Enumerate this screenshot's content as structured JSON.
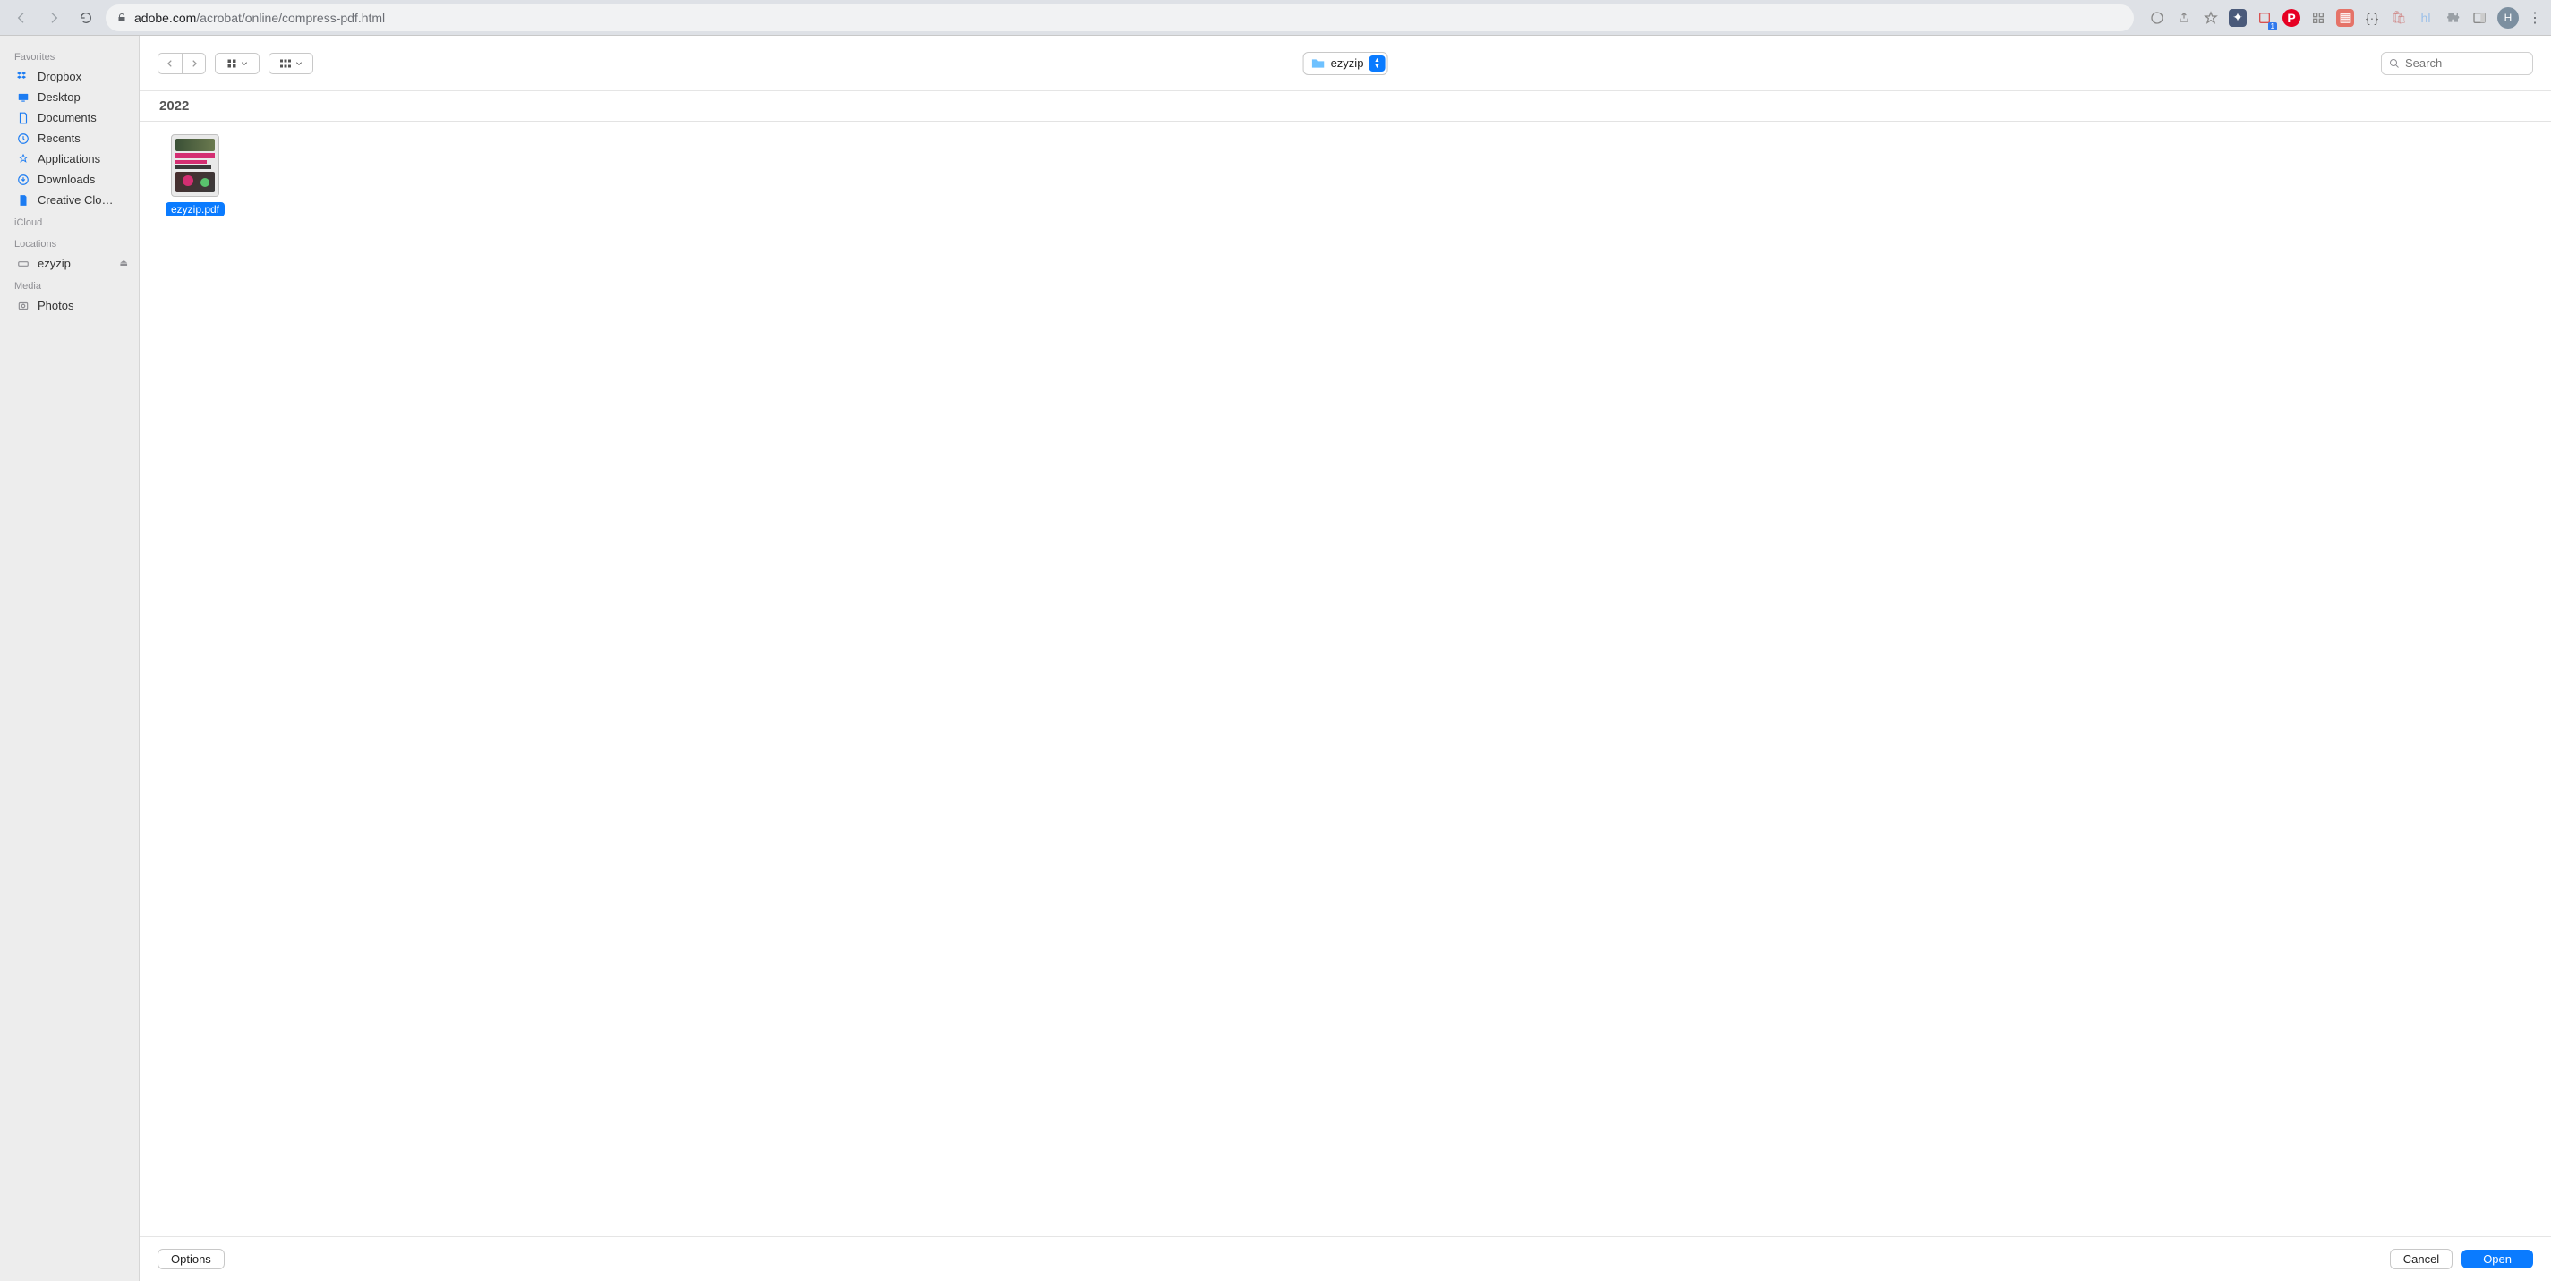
{
  "browser": {
    "url_host": "adobe.com",
    "url_path": "/acrobat/online/compress-pdf.html",
    "avatar_initial": "H",
    "ext_badge": "1"
  },
  "sidebar": {
    "sections": [
      {
        "title": "Favorites",
        "items": [
          {
            "icon": "dropbox-icon",
            "label": "Dropbox"
          },
          {
            "icon": "desktop-icon",
            "label": "Desktop"
          },
          {
            "icon": "documents-icon",
            "label": "Documents"
          },
          {
            "icon": "recents-icon",
            "label": "Recents"
          },
          {
            "icon": "applications-icon",
            "label": "Applications"
          },
          {
            "icon": "downloads-icon",
            "label": "Downloads"
          },
          {
            "icon": "file-icon",
            "label": "Creative Clo…"
          }
        ]
      },
      {
        "title": "iCloud",
        "items": []
      },
      {
        "title": "Locations",
        "items": [
          {
            "icon": "drive-icon",
            "label": "ezyzip",
            "eject": true
          }
        ]
      },
      {
        "title": "Media",
        "items": [
          {
            "icon": "photos-icon",
            "label": "Photos"
          }
        ]
      }
    ]
  },
  "toolbar": {
    "path_label": "ezyzip",
    "search_placeholder": "Search"
  },
  "listing": {
    "group_label": "2022",
    "files": [
      {
        "name": "ezyzip.pdf"
      }
    ]
  },
  "footer": {
    "options_label": "Options",
    "cancel_label": "Cancel",
    "open_label": "Open"
  }
}
